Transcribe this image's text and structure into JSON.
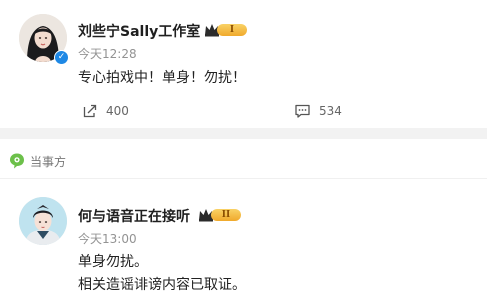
{
  "post1": {
    "author": "刘些宁Sally工作室",
    "level": "I",
    "time": "今天12:28",
    "text": "专心拍戏中！单身！勿扰！",
    "repost_count": "400",
    "comment_count": "534",
    "icons": {
      "repost": "share-icon",
      "comment": "comment-icon",
      "verified": "verified-badge-icon",
      "crown": "crown-icon"
    }
  },
  "section": {
    "label": "当事方",
    "icon": "party-tag-icon"
  },
  "post2": {
    "author": "何与语音正在接听",
    "level": "II",
    "time": "今天13:00",
    "line1": "单身勿扰。",
    "line2": "相关造谣诽谤内容已取证。",
    "icons": {
      "crown": "crown-icon"
    }
  },
  "colors": {
    "verified_blue": "#1e88e5",
    "badge_gold": "#f0a92c",
    "tag_green": "#6cc04a",
    "divider": "#f2f2f2"
  }
}
